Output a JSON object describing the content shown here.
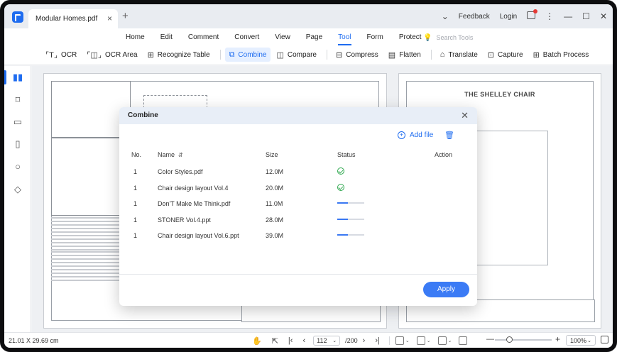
{
  "titlebar": {
    "tab_name": "Modular Homes.pdf",
    "new_tab": "+",
    "feedback": "Feedback",
    "login": "Login"
  },
  "menu": [
    "Home",
    "Edit",
    "Comment",
    "Convert",
    "View",
    "Page",
    "Tool",
    "Form",
    "Protect"
  ],
  "menu_active": "Tool",
  "search_placeholder": "Search Tools",
  "tools": [
    {
      "label": "OCR",
      "icon": "ocr-icon"
    },
    {
      "label": "OCR Area",
      "icon": "ocr-area-icon"
    },
    {
      "label": "Recognize Table",
      "icon": "recognize-table-icon"
    },
    {
      "label": "Combine",
      "icon": "combine-icon",
      "active": true
    },
    {
      "label": "Compare",
      "icon": "compare-icon"
    },
    {
      "label": "Compress",
      "icon": "compress-icon"
    },
    {
      "label": "Flatten",
      "icon": "flatten-icon"
    },
    {
      "label": "Translate",
      "icon": "translate-icon"
    },
    {
      "label": "Capture",
      "icon": "capture-icon"
    },
    {
      "label": "Batch Process",
      "icon": "batch-process-icon"
    }
  ],
  "document": {
    "page2_title": "THE SHELLEY CHAIR"
  },
  "dialog": {
    "title": "Combine",
    "add_file": "Add file",
    "columns": {
      "no": "No.",
      "name": "Name",
      "size": "Size",
      "status": "Status",
      "action": "Action"
    },
    "rows": [
      {
        "no": "1",
        "name": "Color Styles.pdf",
        "size": "12.0M",
        "status": "done"
      },
      {
        "no": "1",
        "name": "Chair design layout Vol.4",
        "size": "20.0M",
        "status": "done"
      },
      {
        "no": "1",
        "name": "Don'T Make Me Think.pdf",
        "size": "11.0M",
        "status": "progress",
        "progress": 0.4
      },
      {
        "no": "1",
        "name": "STONER Vol.4.ppt",
        "size": "28.0M",
        "status": "progress",
        "progress": 0.4
      },
      {
        "no": "1",
        "name": "Chair design layout Vol.6.ppt",
        "size": "39.0M",
        "status": "progress",
        "progress": 0.4
      }
    ],
    "apply_label": "Apply"
  },
  "statusbar": {
    "dimensions": "21.01 X 29.69 cm",
    "current_page": "112",
    "total_pages": "/200",
    "zoom": "100%",
    "zoom_level": 0.25
  },
  "colors": {
    "accent": "#1e6cf0",
    "success": "#2fa84f",
    "apply_button": "#3b7bf5"
  }
}
